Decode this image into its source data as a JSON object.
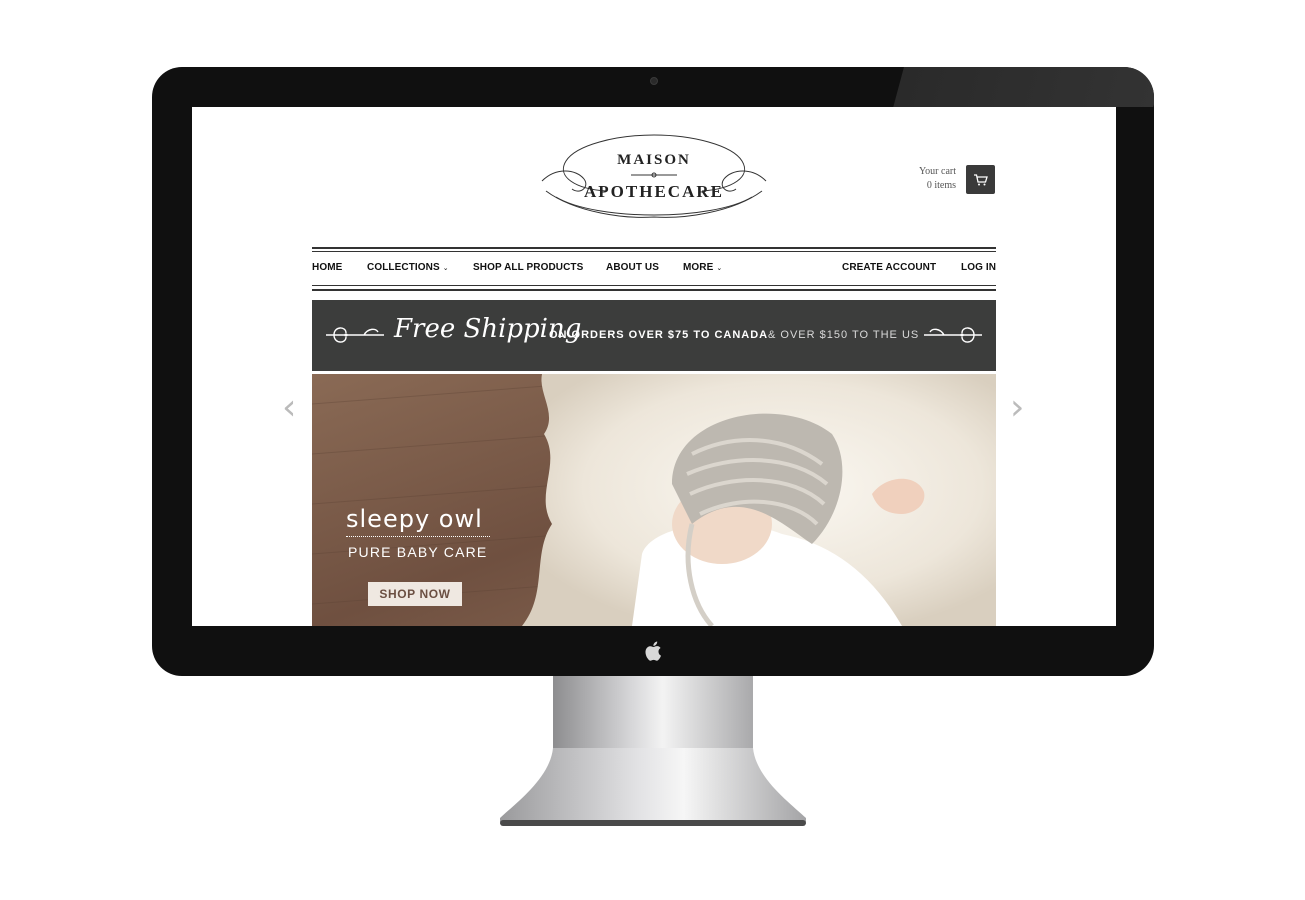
{
  "brand": {
    "top": "MAISON",
    "bottom": "APOTHECARE"
  },
  "cart": {
    "label": "Your cart",
    "count": "0 items"
  },
  "nav": {
    "home": "HOME",
    "collections": "COLLECTIONS",
    "shop_all": "SHOP ALL PRODUCTS",
    "about": "ABOUT US",
    "more": "MORE",
    "create_account": "CREATE ACCOUNT",
    "login": "LOG IN"
  },
  "banner": {
    "script": "Free Shipping",
    "bold": "ON ORDERS OVER $75 TO CANADA",
    "light": "& OVER $150 TO THE US"
  },
  "hero": {
    "title": "sleepy owl",
    "subtitle": "PURE BABY CARE",
    "button": "SHOP NOW"
  },
  "colors": {
    "banner_bg": "#3c3d3c",
    "bezel": "#101010",
    "wood": "#7a5b48",
    "button_bg": "#efe8e1"
  },
  "icons": [
    "cart-icon",
    "chevron-down-icon",
    "arrow-left-icon",
    "arrow-right-icon",
    "apple-icon"
  ]
}
